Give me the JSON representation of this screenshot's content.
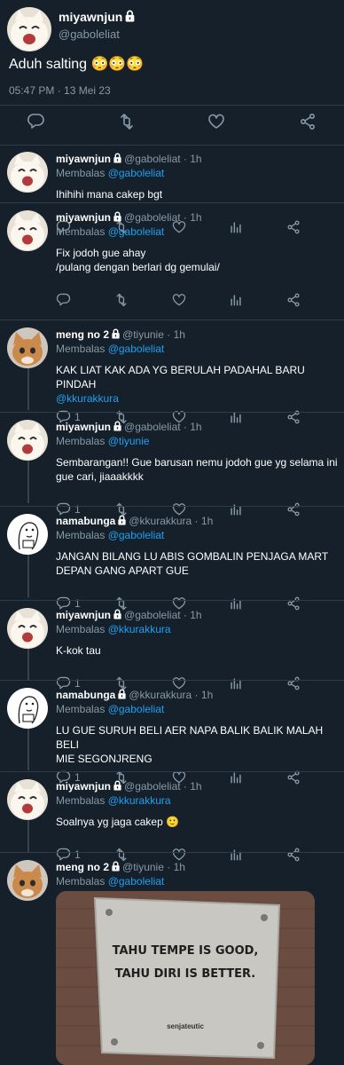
{
  "main": {
    "name": "miyawnjun",
    "handle": "@gaboleliat",
    "text": "Aduh salting 😳😳😳",
    "timestamp": "05:47 PM · 13 Mei 23"
  },
  "replies": [
    {
      "name": "miyawnjun",
      "handle": "@gaboleliat",
      "time": "1h",
      "reply_label": "Membalas",
      "reply_to": "@gaboleliat",
      "lines": [
        "Ihihihi mana cakep bgt"
      ],
      "reply_count": ""
    },
    {
      "name": "miyawnjun",
      "handle": "@gaboleliat",
      "time": "1h",
      "reply_label": "Membalas",
      "reply_to": "@gaboleliat",
      "lines": [
        "Fix jodoh gue ahay",
        "/pulang dengan berlari dg gemulai/"
      ],
      "reply_count": ""
    },
    {
      "name": "meng no 2",
      "handle": "@tiyunie",
      "time": "1h",
      "reply_label": "Membalas",
      "reply_to": "@gaboleliat",
      "lines": [
        "KAK LIAT KAK ADA YG BERULAH PADAHAL BARU PINDAH"
      ],
      "mention_line": "@kkurakkura",
      "reply_count": "1"
    },
    {
      "name": "miyawnjun",
      "handle": "@gaboleliat",
      "time": "1h",
      "reply_label": "Membalas",
      "reply_to": "@tiyunie",
      "lines": [
        "Sembarangan!! Gue barusan nemu jodoh gue yg selama ini",
        "gue cari, jiaaakkkk"
      ],
      "reply_count": "1"
    },
    {
      "name": "namabunga",
      "handle": "@kkurakkura",
      "time": "1h",
      "reply_label": "Membalas",
      "reply_to": "@gaboleliat",
      "lines": [
        "JANGAN BILANG LU ABIS GOMBALIN PENJAGA MART",
        "DEPAN GANG APART GUE"
      ],
      "reply_count": "1"
    },
    {
      "name": "miyawnjun",
      "handle": "@gaboleliat",
      "time": "1h",
      "reply_label": "Membalas",
      "reply_to": "@kkurakkura",
      "lines": [
        "K-kok tau"
      ],
      "reply_count": "1"
    },
    {
      "name": "namabunga",
      "handle": "@kkurakkura",
      "time": "1h",
      "reply_label": "Membalas",
      "reply_to": "@gaboleliat",
      "lines": [
        "LU GUE SURUH BELI AER NAPA BALIK BALIK MALAH BELI",
        "MIE SEGONJRENG"
      ],
      "reply_count": "1"
    },
    {
      "name": "miyawnjun",
      "handle": "@gaboleliat",
      "time": "1h",
      "reply_label": "Membalas",
      "reply_to": "@kkurakkura",
      "lines": [
        "Soalnya yg jaga cakep 🙂"
      ],
      "reply_count": "1"
    },
    {
      "name": "meng no 2",
      "handle": "@tiyunie",
      "time": "1h",
      "reply_label": "Membalas",
      "reply_to": "@gaboleliat",
      "lines": [],
      "reply_count": ""
    }
  ],
  "media": {
    "line1": "TAHU TEMPE IS GOOD,",
    "line2": "TAHU DIRI IS BETTER.",
    "credit": "senjateutic"
  },
  "colors": {
    "background": "#15202b",
    "accent": "#1da1f2",
    "muted": "#8899a6"
  },
  "icons": [
    "lock-icon",
    "reply-icon",
    "retweet-icon",
    "like-icon",
    "analytics-icon",
    "share-icon"
  ]
}
